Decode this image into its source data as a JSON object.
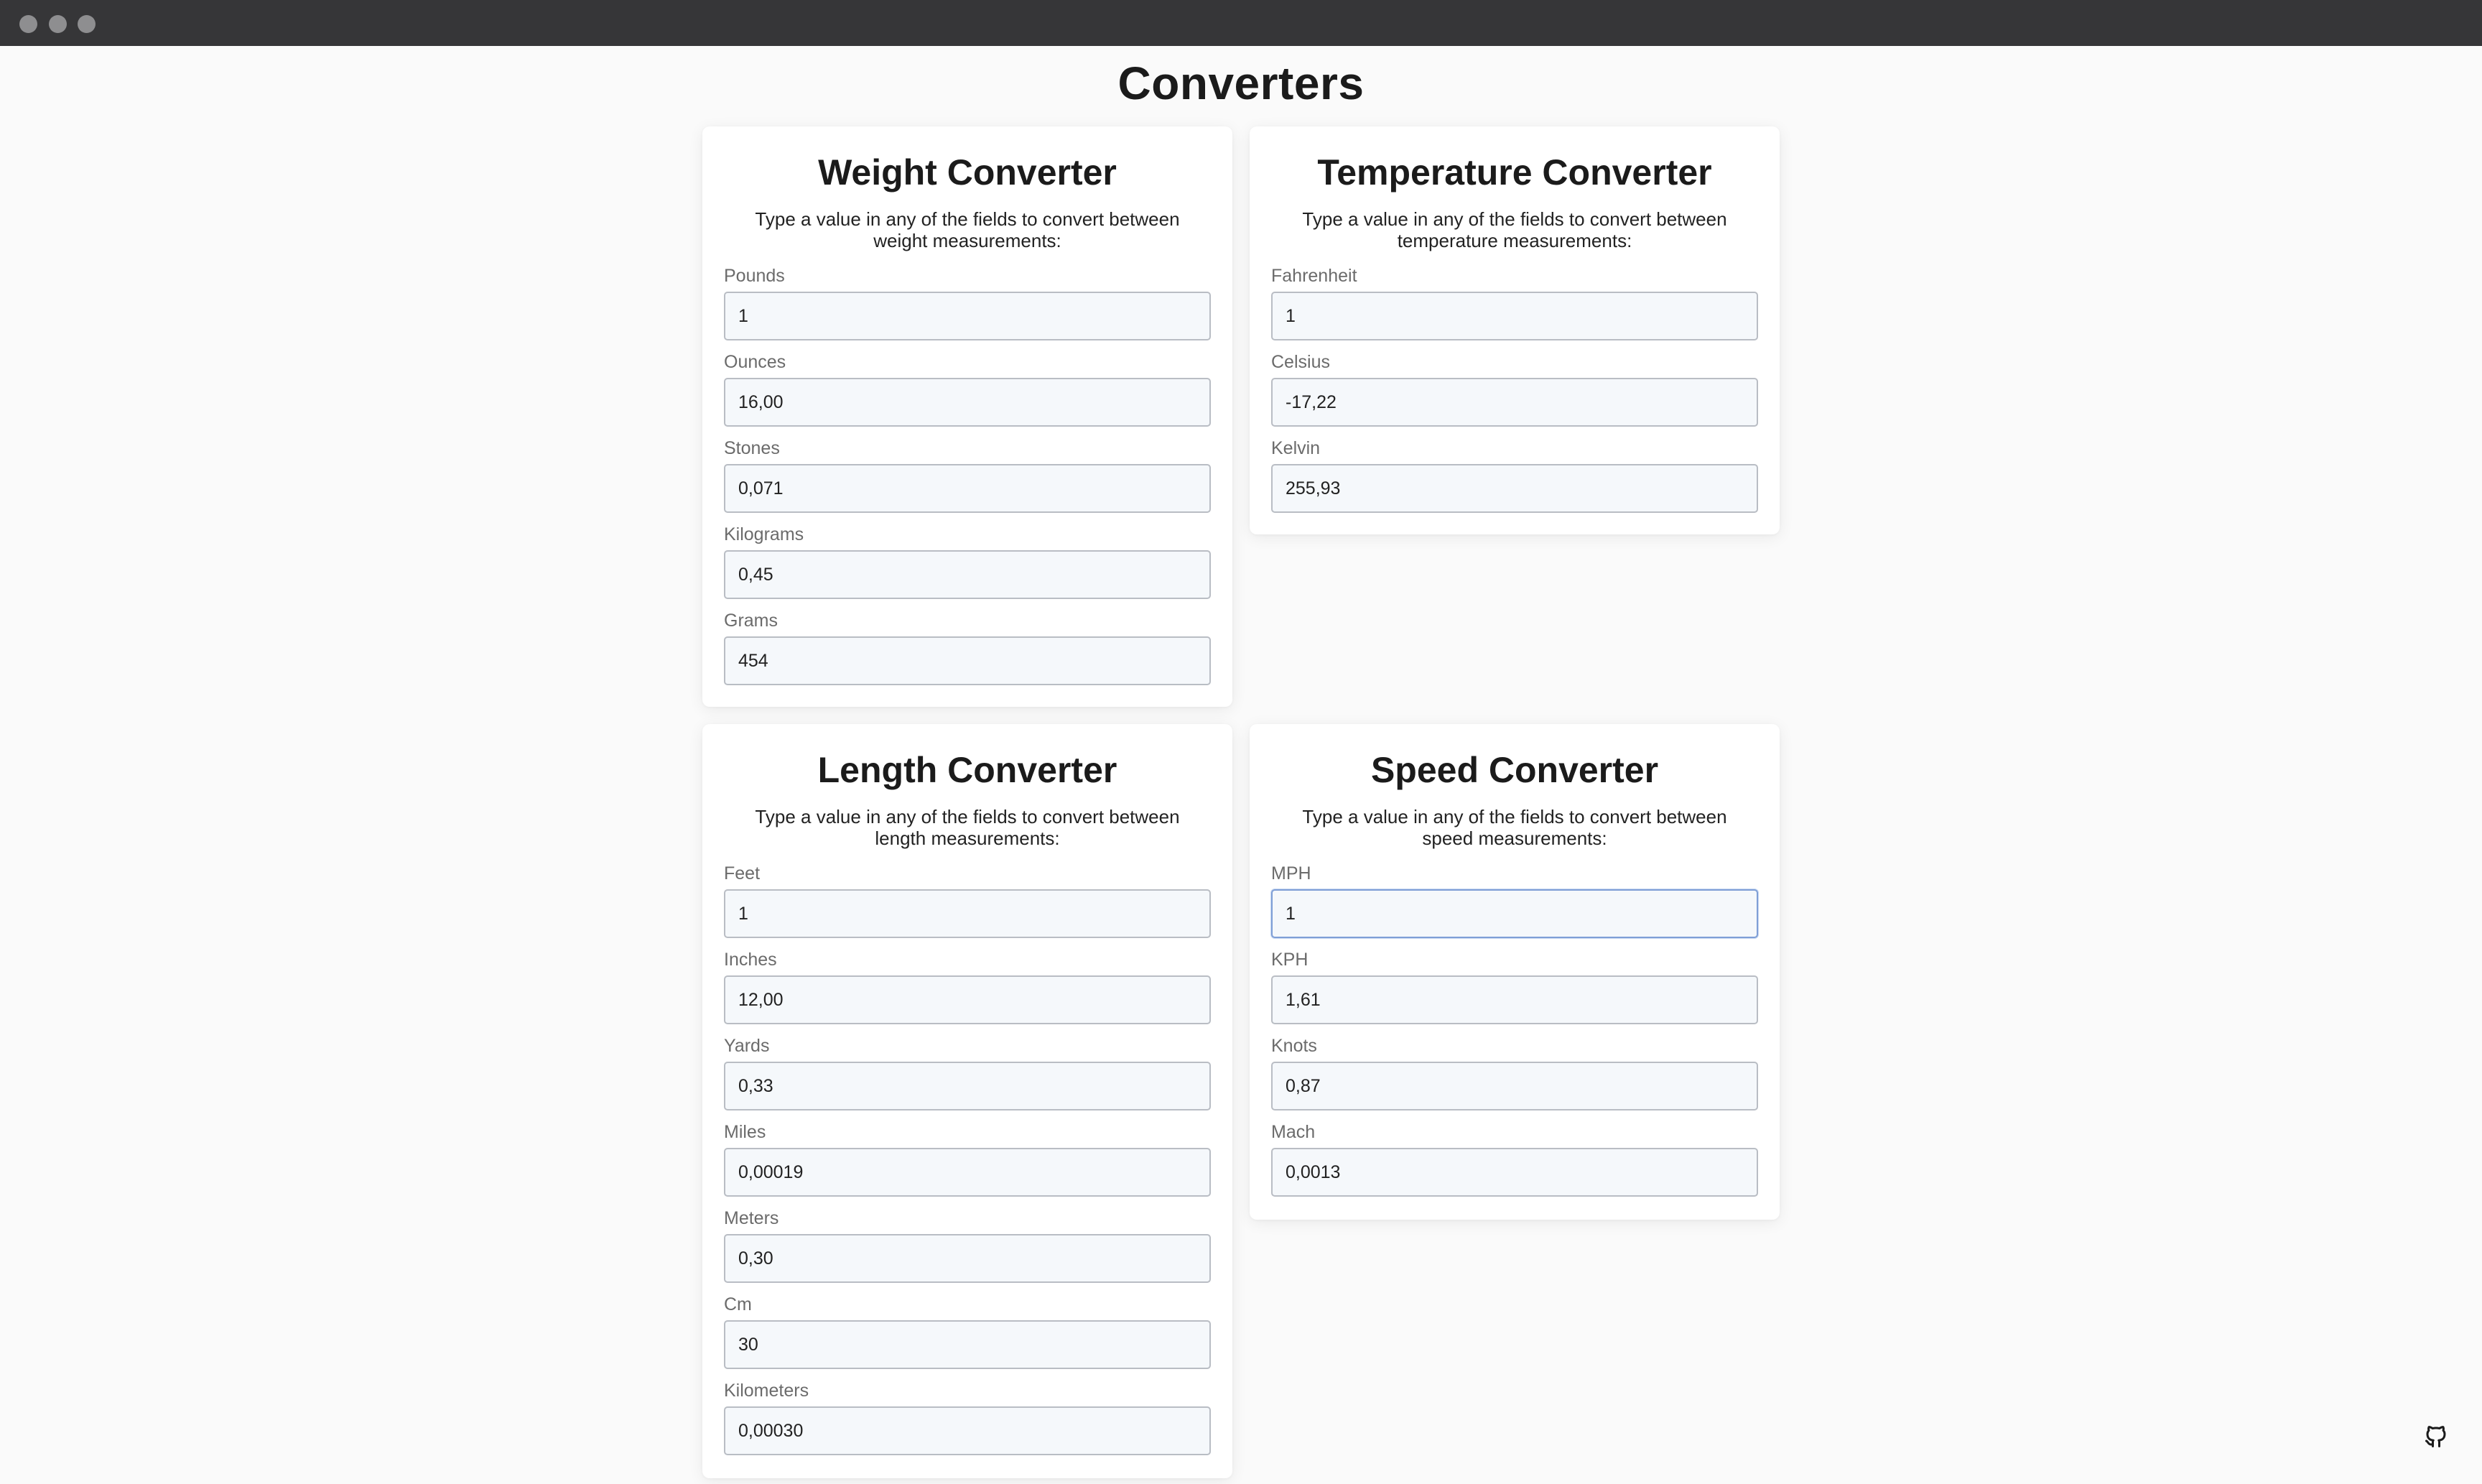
{
  "page": {
    "title": "Converters"
  },
  "converters": [
    {
      "id": "weight",
      "title": "Weight Converter",
      "description": "Type a value in any of the fields to convert between weight measurements:",
      "fields": [
        {
          "label": "Pounds",
          "value": "1"
        },
        {
          "label": "Ounces",
          "value": "16,00"
        },
        {
          "label": "Stones",
          "value": "0,071"
        },
        {
          "label": "Kilograms",
          "value": "0,45"
        },
        {
          "label": "Grams",
          "value": "454"
        }
      ]
    },
    {
      "id": "temperature",
      "title": "Temperature Converter",
      "description": "Type a value in any of the fields to convert between temperature measurements:",
      "fields": [
        {
          "label": "Fahrenheit",
          "value": "1"
        },
        {
          "label": "Celsius",
          "value": "-17,22"
        },
        {
          "label": "Kelvin",
          "value": "255,93"
        }
      ]
    },
    {
      "id": "length",
      "title": "Length Converter",
      "description": "Type a value in any of the fields to convert between length measurements:",
      "fields": [
        {
          "label": "Feet",
          "value": "1"
        },
        {
          "label": "Inches",
          "value": "12,00"
        },
        {
          "label": "Yards",
          "value": "0,33"
        },
        {
          "label": "Miles",
          "value": "0,00019"
        },
        {
          "label": "Meters",
          "value": "0,30"
        },
        {
          "label": "Cm",
          "value": "30"
        },
        {
          "label": "Kilometers",
          "value": "0,00030"
        }
      ]
    },
    {
      "id": "speed",
      "title": "Speed Converter",
      "description": "Type a value in any of the fields to convert between speed measurements:",
      "fields": [
        {
          "label": "MPH",
          "value": "1",
          "focused": true
        },
        {
          "label": "KPH",
          "value": "1,61"
        },
        {
          "label": "Knots",
          "value": "0,87"
        },
        {
          "label": "Mach",
          "value": "0,0013"
        }
      ]
    }
  ],
  "footer": {
    "icon": "github-icon"
  },
  "colors": {
    "titlebar": "#363638",
    "background": "#fafafa",
    "card": "#ffffff",
    "input_bg": "#f5f8fb",
    "input_border": "#b9bdc4",
    "focus_border": "#7f9fd6"
  }
}
